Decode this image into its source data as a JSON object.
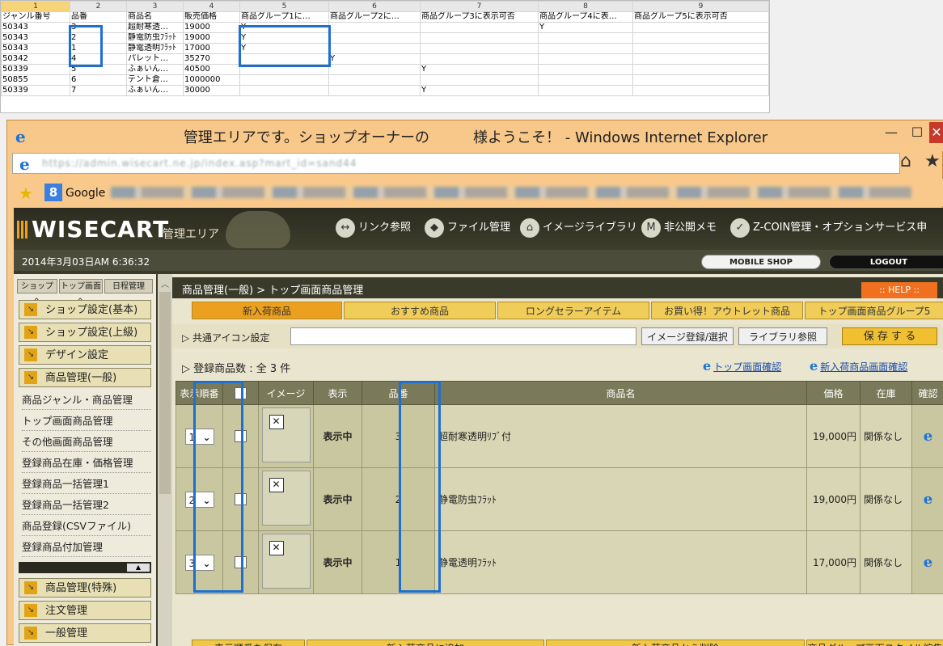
{
  "spreadsheet": {
    "col_numbers": [
      "1",
      "2",
      "3",
      "4",
      "5",
      "6",
      "7",
      "8",
      "9"
    ],
    "headers": [
      "ジャンル番号",
      "品番",
      "商品名",
      "販売価格",
      "商品グループ1に…",
      "商品グループ2に…",
      "商品グループ3に表示可否",
      "商品グループ4に表…",
      "商品グループ5に表示可否"
    ],
    "rows": [
      [
        "50343",
        "3",
        "超耐寒透…",
        "19000",
        "Y",
        "",
        "",
        "Y",
        ""
      ],
      [
        "50343",
        "2",
        "静電防虫ﾌﾗｯﾄ",
        "19000",
        "Y",
        "",
        "",
        "",
        ""
      ],
      [
        "50343",
        "1",
        "静電透明ﾌﾗｯﾄ",
        "17000",
        "Y",
        "",
        "",
        "",
        ""
      ],
      [
        "50342",
        "4",
        "パレット…",
        "35270",
        "",
        "Y",
        "",
        "",
        ""
      ],
      [
        "50339",
        "5",
        "ふぁいん…",
        "40500",
        "",
        "",
        "Y",
        "",
        ""
      ],
      [
        "50855",
        "6",
        "テント倉…",
        "1000000",
        "",
        "",
        "",
        "",
        ""
      ],
      [
        "50339",
        "7",
        "ふぁいん…",
        "30000",
        "",
        "",
        "Y",
        "",
        ""
      ]
    ]
  },
  "window": {
    "title": "管理エリアです。ショップオーナーの　　　様ようこそ！ - Windows Internet Explorer",
    "minimize": "—",
    "maximize": "☐",
    "close": "✕",
    "address": "https://admin.wisecart.ne.jp/index.asp?mart_id=sand44",
    "favorites_google": "Google"
  },
  "header": {
    "logo": "WISECART",
    "logo_sub": "管理エリア",
    "nav": [
      "リンク参照",
      "ファイル管理",
      "イメージライブラリ",
      "非公開メモ",
      "Z-COIN管理・オプションサービス申"
    ],
    "nav_icons": [
      "↔",
      "◆",
      "⌂",
      "M",
      "✓"
    ],
    "date": "2014年3月03日AM 6:36:32",
    "mobile_shop": "MOBILE SHOP",
    "logout": "LOGOUT"
  },
  "sidebar": {
    "mini_tabs": [
      "ショップへ",
      "トップ画面へ",
      "日程管理"
    ],
    "sections": [
      {
        "label": "ショップ設定(基本)"
      },
      {
        "label": "ショップ設定(上級)"
      },
      {
        "label": "デザイン設定"
      },
      {
        "label": "商品管理(一般)"
      }
    ],
    "links": [
      "商品ジャンル・商品管理",
      "トップ画面商品管理",
      "その他画面商品管理",
      "登録商品在庫・価格管理",
      "登録商品一括管理1",
      "登録商品一括管理2",
      "商品登録(CSVファイル)",
      "登録商品付加管理"
    ],
    "sections_after": [
      {
        "label": "商品管理(特殊)"
      },
      {
        "label": "注文管理"
      },
      {
        "label": "一般管理"
      }
    ],
    "arrow": "↘",
    "collapse": "▲",
    "scroll_up": "︿"
  },
  "main": {
    "breadcrumb": "商品管理(一般) > トップ画面商品管理",
    "help": ":: HELP ::",
    "tabs": [
      "新入荷商品",
      "おすすめ商品",
      "ロングセラーアイテム",
      "お買い得！アウトレット商品",
      "トップ画面商品グループ5"
    ],
    "common_icon_label": "▷ 共通アイコン設定",
    "image_register": "イメージ登録/選択",
    "library_ref": "ライブラリ参照",
    "save": "保 存 す る",
    "count_label": "▷ 登録商品数 : 全 3 件",
    "link_top": "トップ画面確認",
    "link_new": "新入荷商品画面確認",
    "ie_glyph": "e",
    "table": {
      "headers": [
        "表示順番",
        "",
        "イメージ",
        "表示",
        "品番",
        "商品名",
        "価格",
        "在庫",
        "確認"
      ],
      "rows": [
        {
          "order": "1",
          "status": "表示中",
          "code": "3",
          "name": "超耐寒透明ﾘﾌﾞ付",
          "price": "19,000円",
          "stock": "関係なし"
        },
        {
          "order": "2",
          "status": "表示中",
          "code": "2",
          "name": "静電防虫ﾌﾗｯﾄ",
          "price": "19,000円",
          "stock": "関係なし"
        },
        {
          "order": "3",
          "status": "表示中",
          "code": "1",
          "name": "静電透明ﾌﾗｯﾄ",
          "price": "17,000円",
          "stock": "関係なし"
        }
      ],
      "img_placeholder": "✕",
      "select_arrow": "⌄"
    },
    "bottom_buttons": [
      "表示順番を保存",
      "新入荷商品に追加",
      "新入荷商品から削除",
      "商品グループ画面スタイル編集"
    ]
  }
}
